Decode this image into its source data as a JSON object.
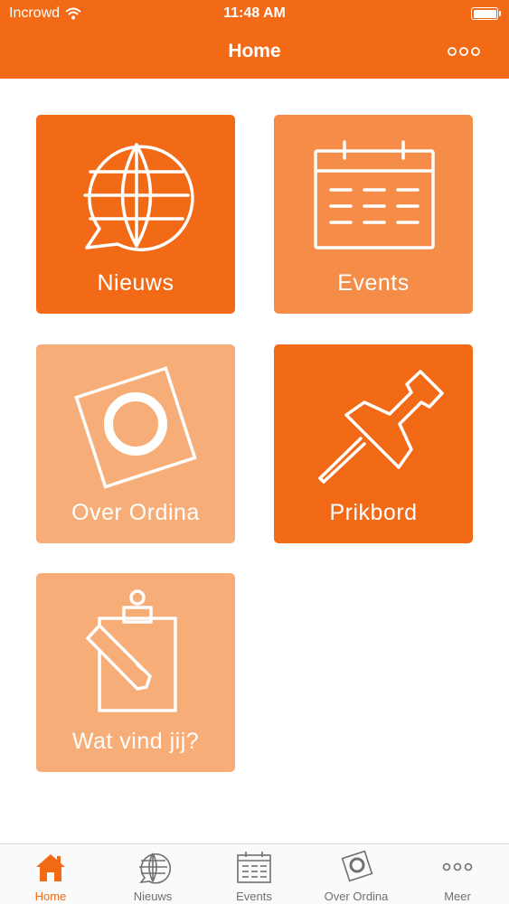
{
  "status_bar": {
    "carrier": "Incrowd",
    "time": "11:48 AM",
    "battery_level": 1.0
  },
  "nav": {
    "title": "Home",
    "more_icon": "more-icon"
  },
  "tiles": [
    {
      "label": "Nieuws",
      "icon": "globe-chat-icon",
      "color": "#f36a16"
    },
    {
      "label": "Events",
      "icon": "calendar-icon",
      "color": "#f58c47"
    },
    {
      "label": "Over Ordina",
      "icon": "ordina-logo-icon",
      "color": "#f7ad77"
    },
    {
      "label": "Prikbord",
      "icon": "pushpin-icon",
      "color": "#f36a16"
    },
    {
      "label": "Wat vind jij?",
      "icon": "clipboard-pencil-icon",
      "color": "#f7ad77"
    }
  ],
  "tabbar": {
    "items": [
      {
        "label": "Home",
        "icon": "home-icon",
        "active": true
      },
      {
        "label": "Nieuws",
        "icon": "globe-icon",
        "active": false
      },
      {
        "label": "Events",
        "icon": "calendar-icon",
        "active": false
      },
      {
        "label": "Over Ordina",
        "icon": "ordina-logo-icon",
        "active": false
      },
      {
        "label": "Meer",
        "icon": "more-icon",
        "active": false
      }
    ]
  },
  "colors": {
    "brand_orange": "#f36a16",
    "tile_mid": "#f58c47",
    "tile_light": "#f7ad77",
    "tab_inactive": "#707070"
  }
}
